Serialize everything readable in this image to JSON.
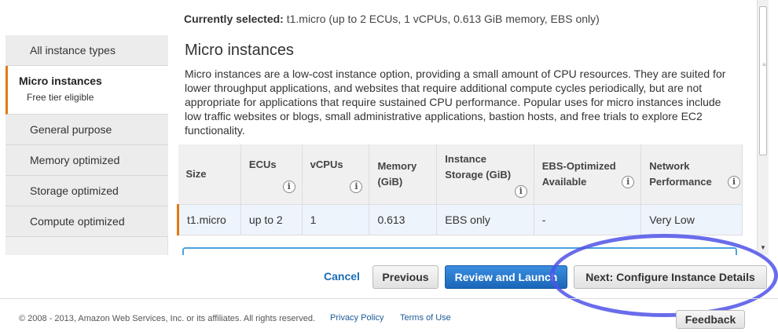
{
  "selection": {
    "label": "Currently selected:",
    "value": "t1.micro (up to 2 ECUs, 1 vCPUs, 0.613 GiB memory, EBS only)"
  },
  "sidebar": {
    "items": [
      {
        "label": "All instance types"
      },
      {
        "label": "Micro instances",
        "sublabel": "Free tier eligible"
      },
      {
        "label": "General purpose"
      },
      {
        "label": "Memory optimized"
      },
      {
        "label": "Storage optimized"
      },
      {
        "label": "Compute optimized"
      }
    ]
  },
  "content": {
    "title": "Micro instances",
    "description": "Micro instances are a low-cost instance option, providing a small amount of CPU resources. They are suited for lower throughput applications, and websites that require additional compute cycles periodically, but are not appropriate for applications that require sustained CPU performance. Popular uses for micro instances include low traffic websites or blogs, small administrative applications, bastion hosts, and free trials to explore EC2 functionality."
  },
  "table": {
    "headers": [
      {
        "line1": "Size",
        "line2": ""
      },
      {
        "line1": "ECUs",
        "line2": ""
      },
      {
        "line1": "vCPUs",
        "line2": ""
      },
      {
        "line1": "Memory",
        "line2": "(GiB)"
      },
      {
        "line1": "Instance",
        "line2": "Storage (GiB)"
      },
      {
        "line1": "EBS-Optimized",
        "line2": "Available"
      },
      {
        "line1": "Network",
        "line2": "Performance"
      }
    ],
    "info_icon": "i",
    "rows": [
      [
        "t1.micro",
        "up to 2",
        "1",
        "0.613",
        "EBS only",
        "-",
        "Very Low"
      ]
    ]
  },
  "buttons": {
    "cancel": "Cancel",
    "previous": "Previous",
    "review": "Review and Launch",
    "next": "Next: Configure Instance Details"
  },
  "footer": {
    "copyright": "© 2008 - 2013, Amazon Web Services, Inc. or its affiliates. All rights reserved.",
    "privacy": "Privacy Policy",
    "terms": "Terms of Use",
    "feedback": "Feedback"
  },
  "colors": {
    "accent_orange": "#e47911",
    "primary_blue": "#1a66b8",
    "highlight_ring": "#4f52e8"
  }
}
